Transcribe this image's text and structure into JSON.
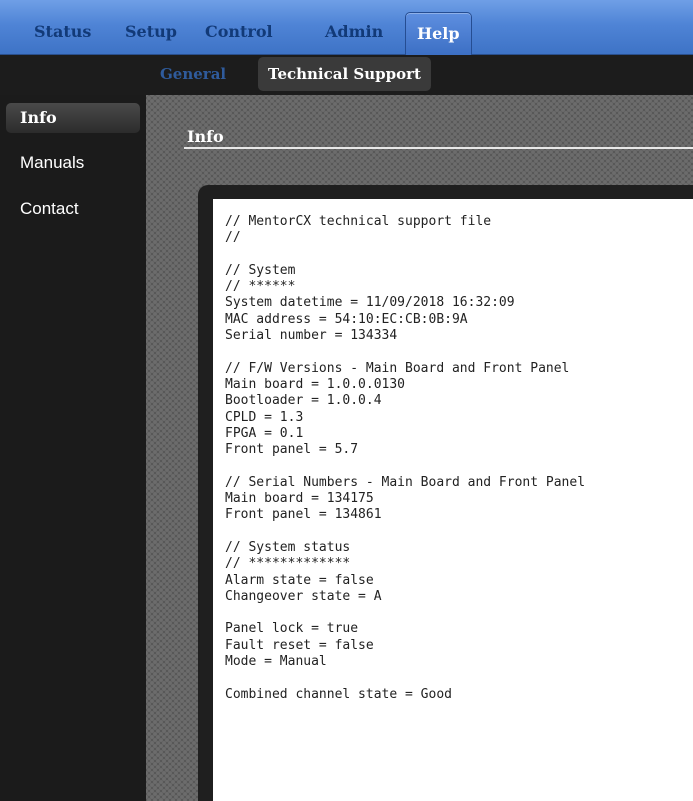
{
  "topnav": {
    "tabs": [
      {
        "label": "Status"
      },
      {
        "label": "Setup"
      },
      {
        "label": "Control"
      },
      {
        "label": "Admin"
      },
      {
        "label": "Help"
      }
    ],
    "active": "Help"
  },
  "subnav": {
    "tabs": [
      {
        "label": "General"
      },
      {
        "label": "Technical Support"
      }
    ],
    "active": "Technical Support"
  },
  "sidebar": {
    "items": [
      {
        "label": "Info"
      },
      {
        "label": "Manuals"
      },
      {
        "label": "Contact"
      }
    ],
    "active": "Info"
  },
  "main": {
    "section_title": "Info",
    "file_lines": [
      "// MentorCX technical support file",
      "//",
      "",
      "// System",
      "// ******",
      "System datetime = 11/09/2018 16:32:09",
      "MAC address = 54:10:EC:CB:0B:9A",
      "Serial number = 134334",
      "",
      "// F/W Versions - Main Board and Front Panel",
      "Main board = 1.0.0.0130",
      "Bootloader = 1.0.0.4",
      "CPLD = 1.3",
      "FPGA = 0.1",
      "Front panel = 5.7",
      "",
      "// Serial Numbers - Main Board and Front Panel",
      "Main board = 134175",
      "Front panel = 134861",
      "",
      "// System status",
      "// *************",
      "Alarm state = false",
      "Changeover state = A",
      "",
      "Panel lock = true",
      "Fault reset = false",
      "Mode = Manual",
      "",
      "Combined channel state = Good"
    ]
  },
  "colors": {
    "topnav": "#4f84d6",
    "topnav_text": "#123a78",
    "subnav_inactive_text": "#2f5b9c",
    "panel_background": "#565656"
  }
}
